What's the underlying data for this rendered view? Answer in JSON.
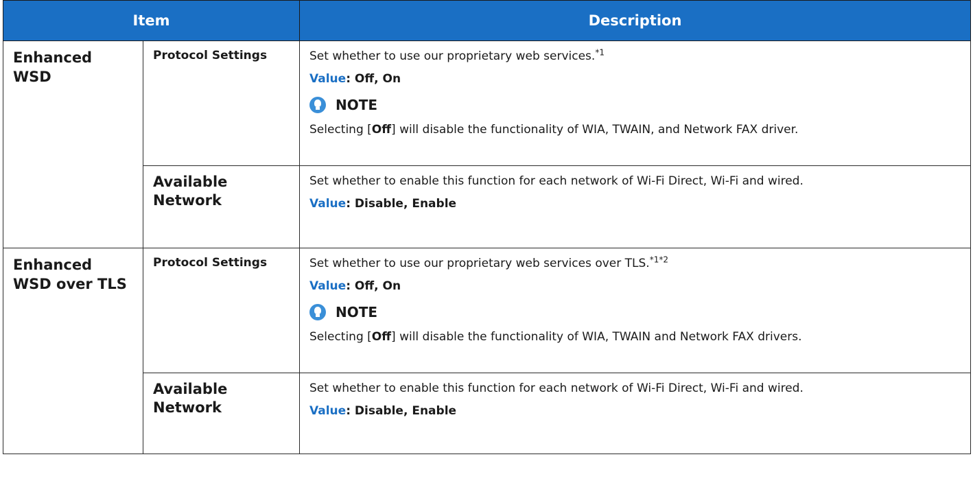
{
  "header": {
    "item": "Item",
    "description": "Description"
  },
  "rows": [
    {
      "group": "Enhanced WSD",
      "setting": "Protocol Settings",
      "text": "Set whether to use our proprietary web services.",
      "sup": "*1",
      "value_label": "Value",
      "value": ": Off, On",
      "note_label": "NOTE",
      "note_pre": "Selecting [",
      "note_bold": "Off",
      "note_post": "] will disable the functionality of WIA, TWAIN, and Network FAX driver."
    },
    {
      "setting": "Available Network",
      "text": "Set whether to enable this function for each network of Wi-Fi Direct, Wi-Fi and wired.",
      "value_label": "Value",
      "value": ": Disable, Enable"
    },
    {
      "group": "Enhanced WSD over TLS",
      "setting": "Protocol Settings",
      "text": "Set whether to use our proprietary web services over TLS.",
      "sup": "*1*2",
      "value_label": "Value",
      "value": ": Off, On",
      "note_label": "NOTE",
      "note_pre": "Selecting [",
      "note_bold": "Off",
      "note_post": "] will disable the functionality of WIA, TWAIN and Network FAX drivers."
    },
    {
      "setting": "Available Network",
      "text": "Set whether to enable this function for each network of Wi-Fi Direct, Wi-Fi and wired.",
      "value_label": "Value",
      "value": ": Disable, Enable"
    }
  ]
}
